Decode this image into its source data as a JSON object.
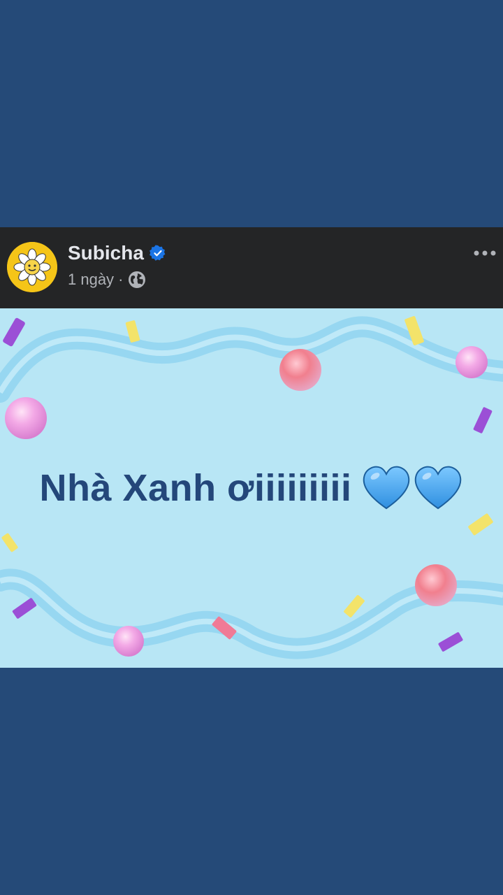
{
  "post": {
    "author_name": "Subicha",
    "time_label": "1 ngày",
    "separator": "·",
    "privacy_icon": "globe-icon",
    "verified_icon": "verified-badge-icon",
    "more_icon": "more-options-icon"
  },
  "media": {
    "caption": "Nhà Xanh ơiiiiiiiii",
    "emoji": [
      "blue-heart-icon",
      "blue-heart-icon"
    ],
    "background_color": "#b8e6f5",
    "text_color": "#24477a"
  },
  "colors": {
    "page_bg": "#254a78",
    "header_bg": "#242526",
    "verified_blue": "#1b74e4"
  }
}
